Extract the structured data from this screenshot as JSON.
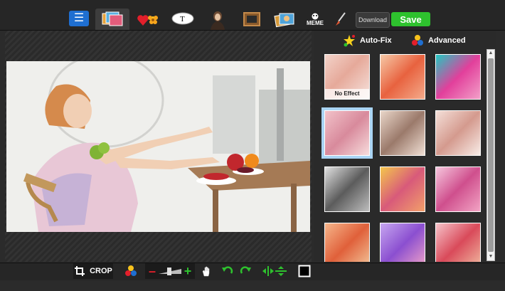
{
  "toolbar": {
    "download_label": "Download",
    "save_label": "Save",
    "meme_label": "MEME",
    "text_tool_label": "T"
  },
  "panel": {
    "autofix_label": "Auto-Fix",
    "advanced_label": "Advanced",
    "no_effect_label": "No Effect"
  },
  "bottom": {
    "crop_label": "CROP"
  },
  "colors": {
    "accent_blue": "#1f6fd1",
    "save_green": "#2ec22e",
    "selection": "#a9d4f4"
  }
}
